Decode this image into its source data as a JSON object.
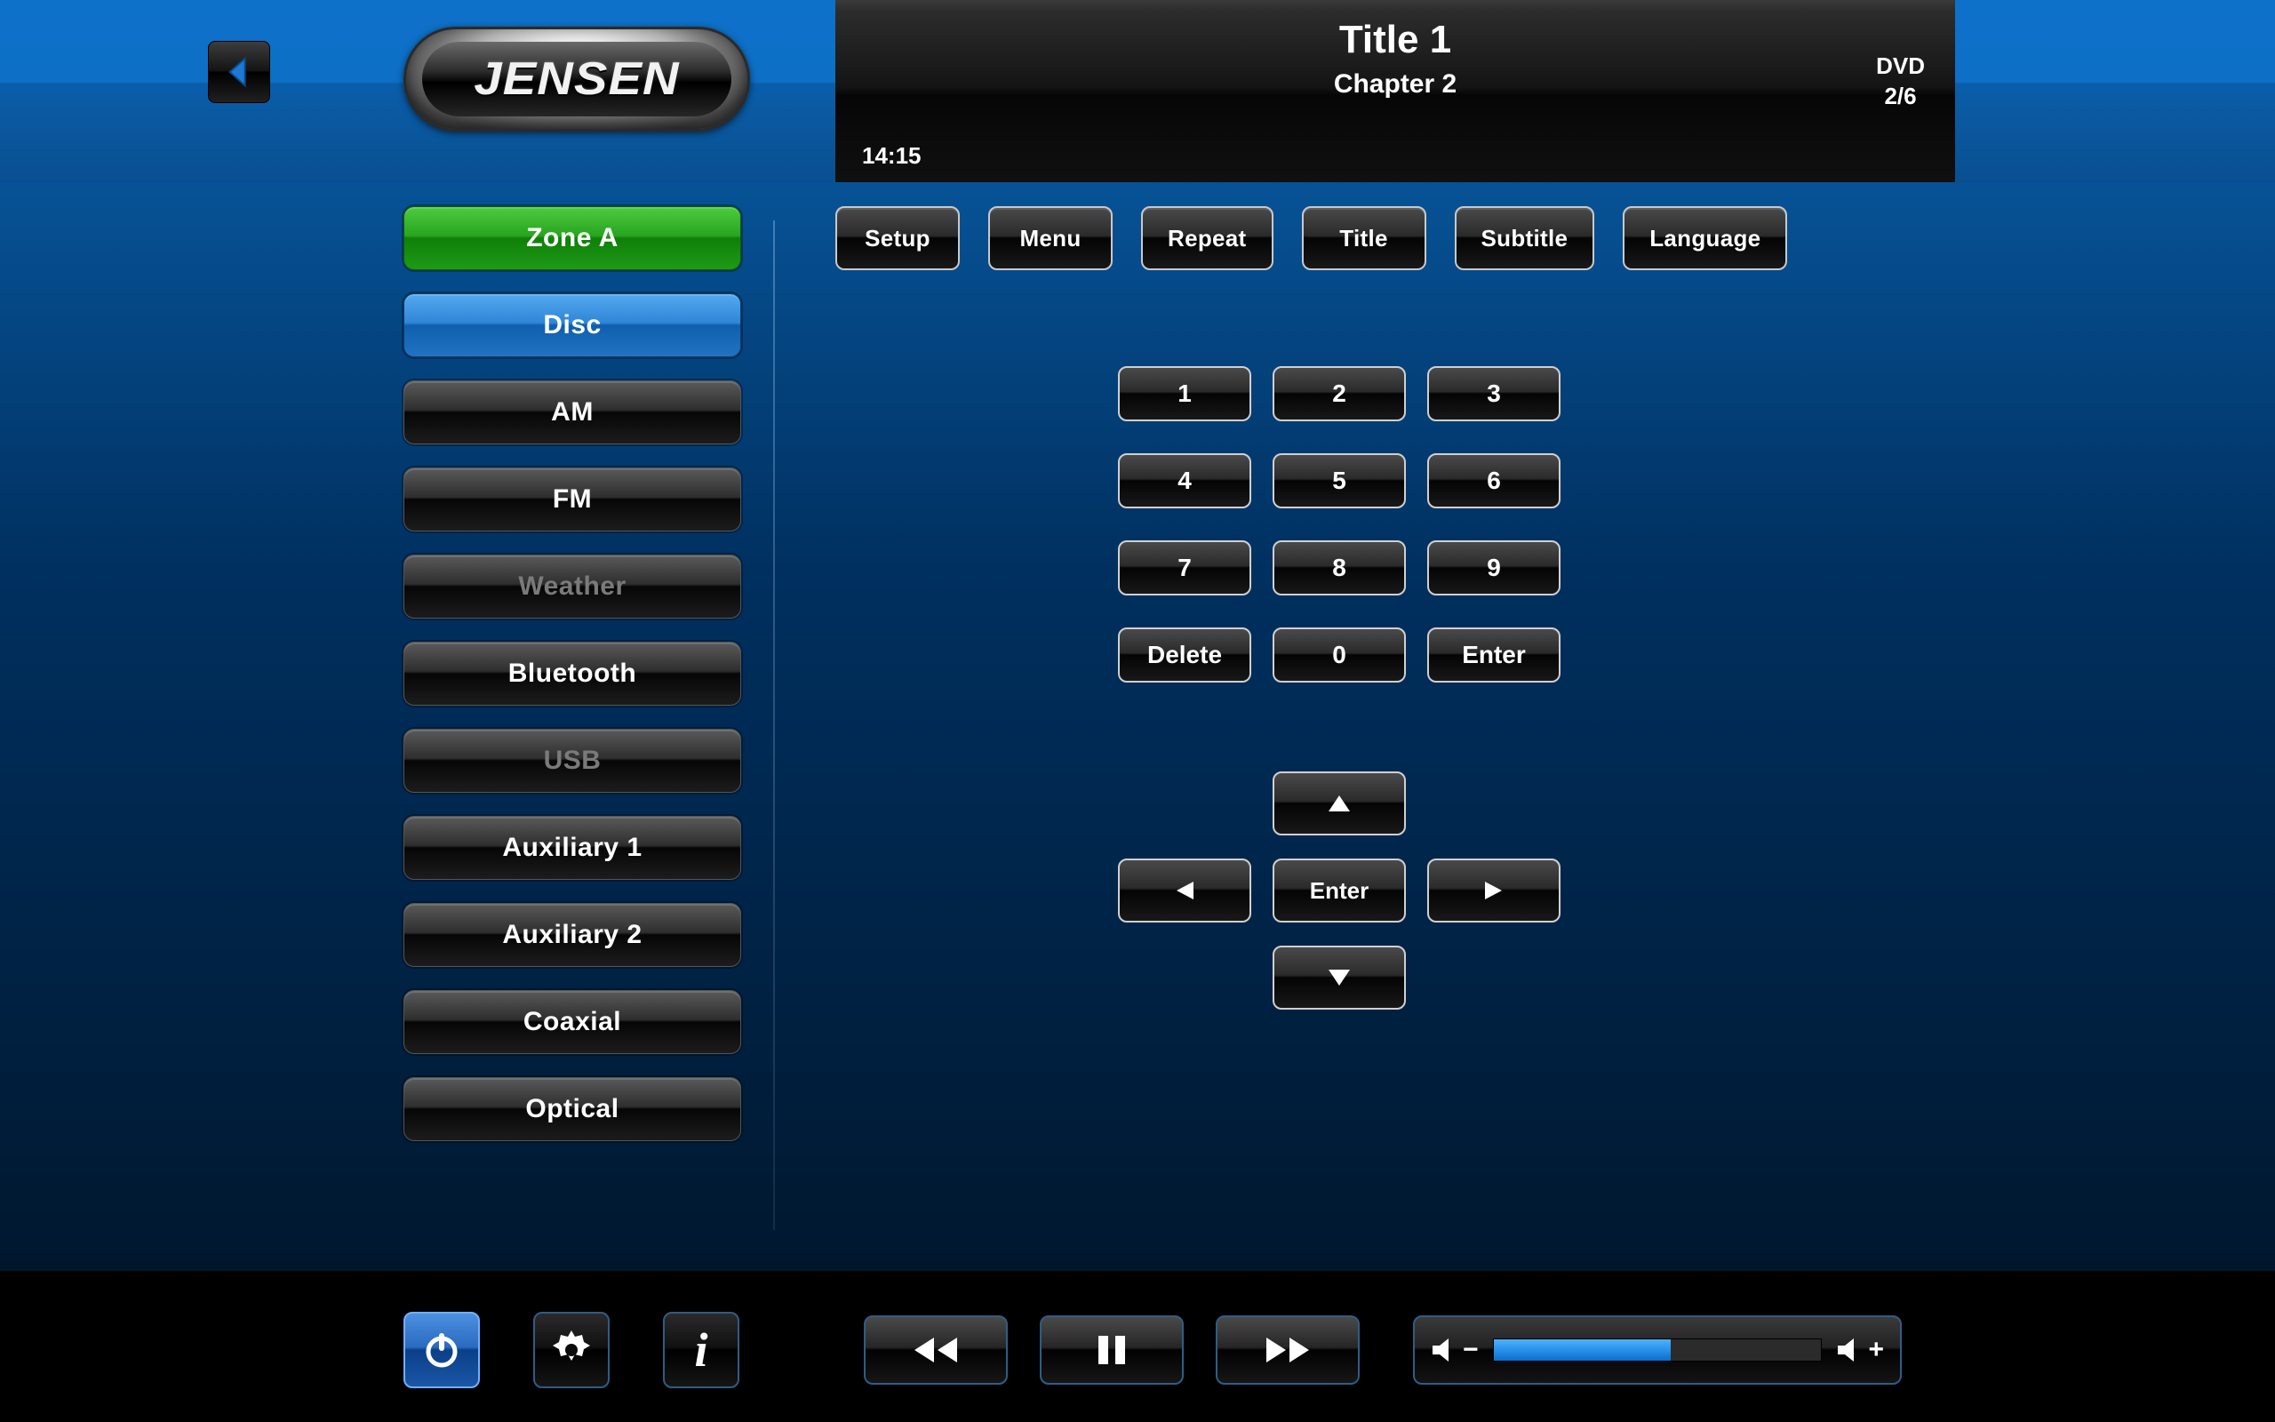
{
  "header": {
    "brand": "JENSEN",
    "display": {
      "title": "Title 1",
      "chapter": "Chapter 2",
      "media_type": "DVD",
      "position": "2/6",
      "elapsed": "14:15"
    }
  },
  "sidebar": {
    "zone_label": "Zone A",
    "items": [
      {
        "label": "Disc",
        "state": "active"
      },
      {
        "label": "AM",
        "state": "normal"
      },
      {
        "label": "FM",
        "state": "normal"
      },
      {
        "label": "Weather",
        "state": "disabled"
      },
      {
        "label": "Bluetooth",
        "state": "normal"
      },
      {
        "label": "USB",
        "state": "disabled"
      },
      {
        "label": "Auxiliary 1",
        "state": "normal"
      },
      {
        "label": "Auxiliary 2",
        "state": "normal"
      },
      {
        "label": "Coaxial",
        "state": "normal"
      },
      {
        "label": "Optical",
        "state": "normal"
      }
    ]
  },
  "toolbar": {
    "setup": "Setup",
    "menu": "Menu",
    "repeat": "Repeat",
    "title": "Title",
    "subtitle": "Subtitle",
    "language": "Language"
  },
  "keypad": {
    "k1": "1",
    "k2": "2",
    "k3": "3",
    "k4": "4",
    "k5": "5",
    "k6": "6",
    "k7": "7",
    "k8": "8",
    "k9": "9",
    "delete": "Delete",
    "k0": "0",
    "enter": "Enter"
  },
  "dpad": {
    "enter": "Enter"
  },
  "footer": {
    "volume_percent": 54
  }
}
